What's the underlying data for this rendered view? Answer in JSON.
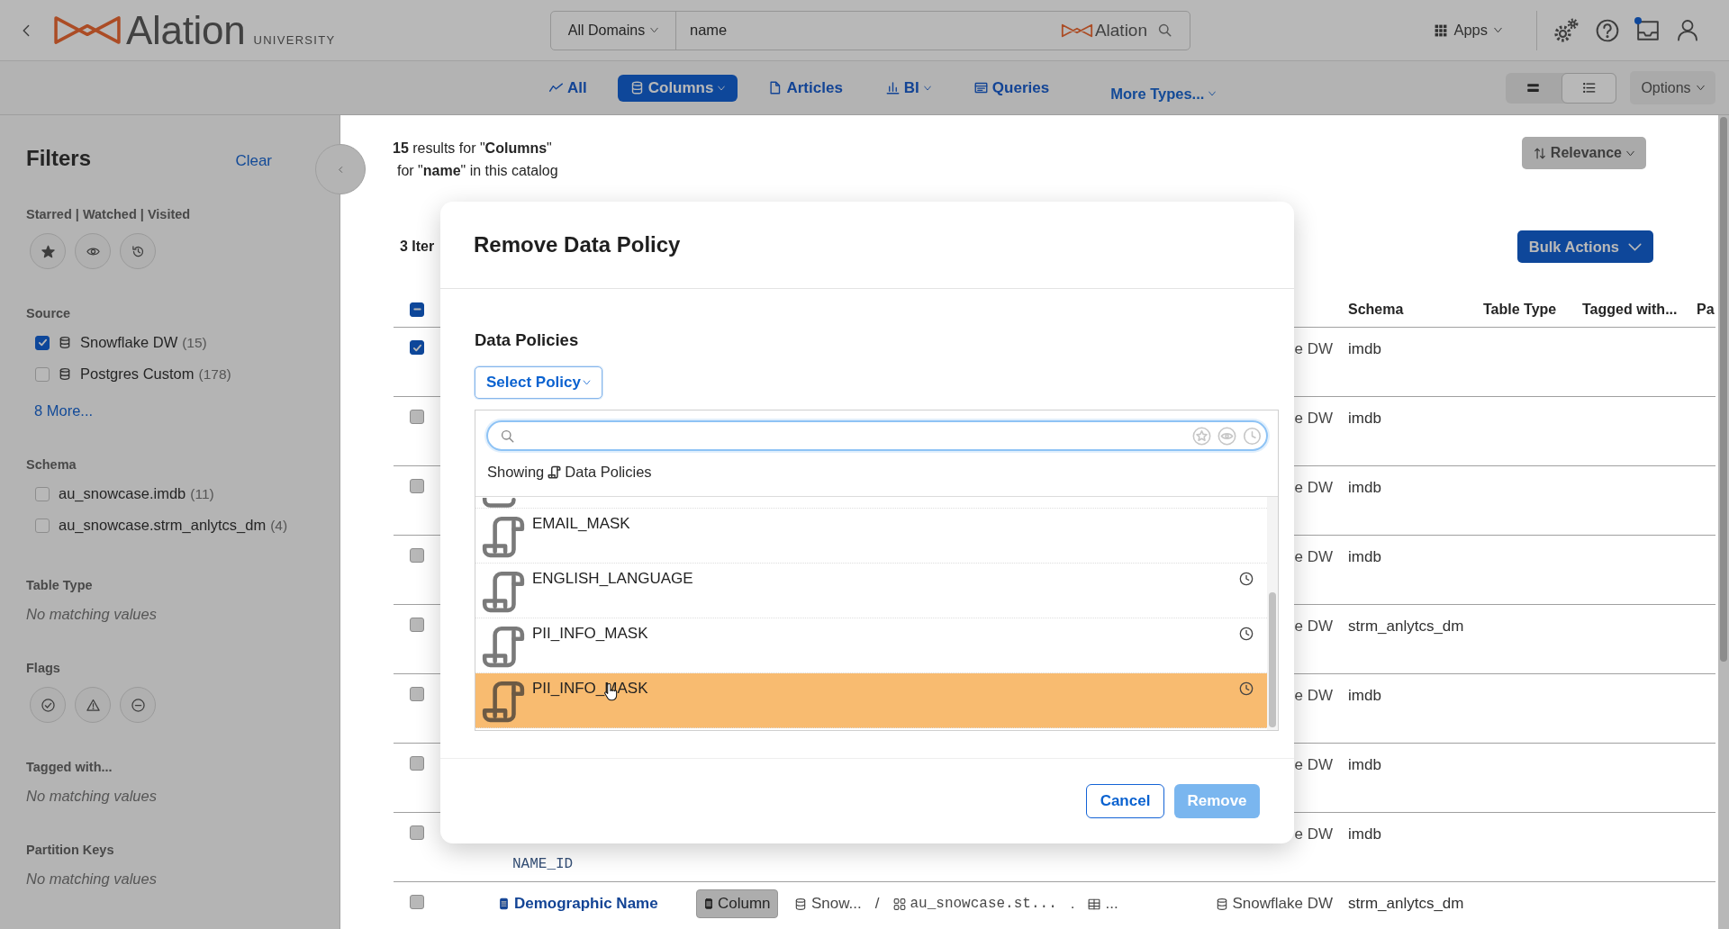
{
  "header": {
    "brand": "Alation",
    "brand_sub": "UNIVERSITY",
    "search": {
      "scope": "All Domains",
      "value": "name",
      "brand": "Alation"
    },
    "apps": "Apps",
    "unread": true
  },
  "type_tabs": [
    {
      "kind": "all",
      "label": "All",
      "selected": false,
      "menu": false
    },
    {
      "kind": "columns",
      "label": "Columns",
      "selected": true,
      "menu": true
    },
    {
      "kind": "articles",
      "label": "Articles",
      "selected": false,
      "menu": false
    },
    {
      "kind": "bi",
      "label": "BI",
      "selected": false,
      "menu": true
    },
    {
      "kind": "queries",
      "label": "Queries",
      "selected": false,
      "menu": false
    },
    {
      "kind": "more",
      "label": "More Types...",
      "selected": false,
      "menu": true
    }
  ],
  "view_modes": [
    {
      "kind": "compact",
      "selected": false
    },
    {
      "kind": "detailed",
      "selected": true
    }
  ],
  "options_menu": "Options",
  "filters": {
    "title": "Filters",
    "clear": "Clear",
    "sections": [
      {
        "kind": "toggles",
        "title": "Starred | Watched | Visited",
        "items": [
          {
            "kind": "starred"
          },
          {
            "kind": "watched"
          },
          {
            "kind": "visited"
          }
        ]
      },
      {
        "kind": "checklist",
        "title": "Source",
        "items": [
          {
            "kind": "database",
            "label": "Snowflake DW",
            "count": "(15)",
            "checked": true
          },
          {
            "kind": "database",
            "label": "Postgres Custom",
            "count": "(178)",
            "checked": false
          }
        ],
        "more": "8 More..."
      },
      {
        "kind": "checklist",
        "title": "Schema",
        "items": [
          {
            "kind": "plain",
            "label": "au_snowcase.imdb",
            "count": "(11)",
            "checked": false
          },
          {
            "kind": "plain",
            "label": "au_snowcase.strm_anlytcs_dm",
            "count": "(4)",
            "checked": false
          }
        ]
      },
      {
        "kind": "empty",
        "title": "Table Type",
        "note": "No matching values"
      },
      {
        "kind": "toggles",
        "title": "Flags",
        "items": [
          {
            "kind": "endorsed"
          },
          {
            "kind": "warning"
          },
          {
            "kind": "deprecated"
          }
        ]
      },
      {
        "kind": "empty",
        "title": "Tagged with...",
        "note": "No matching values"
      },
      {
        "kind": "empty",
        "title": "Partition Keys",
        "note": "No matching values"
      }
    ]
  },
  "results": {
    "summary": [
      "**15** results for \"**Columns**\"",
      "for \"**name**\" in this catalog"
    ],
    "sort": "Relevance",
    "selection": "3 Iter",
    "bulk_actions": "Bulk Actions"
  },
  "table": {
    "select_all": {
      "checked": true,
      "partial": true
    },
    "columns": [
      "Schema",
      "Table Type",
      "Tagged with...",
      "Pa"
    ],
    "rows": [
      {
        "kind": "covered",
        "checked": true,
        "source": "e DW",
        "schema": "imdb"
      },
      {
        "kind": "covered",
        "checked": false,
        "source": "e DW",
        "schema": "imdb"
      },
      {
        "kind": "covered",
        "checked": false,
        "source": "e DW",
        "schema": "imdb"
      },
      {
        "kind": "covered",
        "checked": false,
        "source": "e DW",
        "schema": "imdb"
      },
      {
        "kind": "covered",
        "checked": false,
        "source": "e DW",
        "schema": "strm_anlytcs_dm"
      },
      {
        "kind": "covered",
        "checked": false,
        "source": "e DW",
        "schema": "imdb"
      },
      {
        "kind": "covered",
        "checked": false,
        "source": "e DW",
        "schema": "imdb"
      },
      {
        "kind": "covered",
        "checked": false,
        "detail": "NAME_ID",
        "source": "e DW",
        "schema": "imdb"
      },
      {
        "kind": "full",
        "checked": false,
        "name": "Demographic Name",
        "type": "Column",
        "path": [
          {
            "kind": "source",
            "text": "Snow..."
          },
          {
            "kind": "separator",
            "text": "/"
          },
          {
            "kind": "schema",
            "text": "au_snowcase.st..."
          },
          {
            "kind": "separator",
            "text": "."
          },
          {
            "kind": "table",
            "text": "..."
          }
        ],
        "source": "Snowflake DW",
        "schema": "strm_anlytcs_dm"
      }
    ]
  },
  "dialog": {
    "title": "Remove Data Policy",
    "field_label": "Data Policies",
    "picker": {
      "label": "Select Policy",
      "expanded": true
    },
    "showing": {
      "prefix": "Showing",
      "label": "Data Policies"
    },
    "options": [
      {
        "name": "EMAIL_MASK",
        "recent": false,
        "selected": false
      },
      {
        "name": "ENGLISH_LANGUAGE",
        "recent": true,
        "selected": false
      },
      {
        "name": "PII_INFO_MASK",
        "recent": true,
        "selected": false
      },
      {
        "name": "PII_INFO_MASK",
        "recent": true,
        "selected": true
      }
    ],
    "buttons": [
      {
        "kind": "secondary",
        "label": "Cancel",
        "disabled": false
      },
      {
        "kind": "primary",
        "label": "Remove",
        "disabled": true
      }
    ]
  }
}
